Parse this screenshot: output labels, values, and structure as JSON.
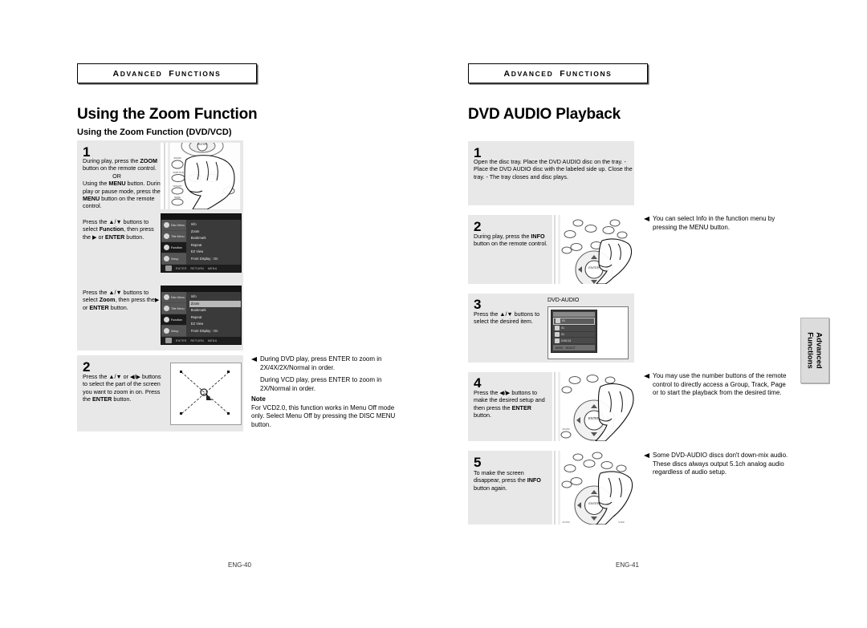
{
  "document": {
    "type": "product-manual-spread",
    "banner_label": "ADVANCED FUNCTIONS"
  },
  "side_tab": {
    "line1": "Advanced",
    "line2": "Functions"
  },
  "left_page": {
    "banner": "ADVANCED FUNCTIONS",
    "title": "Using the Zoom Function",
    "subtitle": "Using the Zoom Function (DVD/VCD)",
    "folio": "ENG-40",
    "step1": {
      "number": "1",
      "lines": [
        "During play, press the ZOOM",
        "button on the remote control.",
        "OR",
        "Using the MENU button.",
        "During play or pause mode,",
        "press the MENU button on",
        "the remote control."
      ],
      "lines2": [
        "Press the ▲/▼ buttons to",
        "select Function, then",
        "press the ▶ or ENTER",
        "button."
      ],
      "lines3": [
        "Press the ▲/▼ buttons to",
        "select Zoom, then press",
        "the▶ or ENTER button."
      ]
    },
    "step2": {
      "number": "2",
      "lines": [
        "Press the ▲/▼ or ◀/▶",
        "buttons to select the part",
        "of the screen you want to",
        "zoom in on.",
        "Press the ENTER button."
      ]
    },
    "osd_menu_1": {
      "sidebar": [
        "Disc Menu",
        "Title Menu",
        "Function",
        "Setup"
      ],
      "selected_sidebar": "Function",
      "rows": [
        "Info",
        "Zoom",
        "Bookmark",
        "Repeat",
        "EZ View",
        "Front Display : On"
      ],
      "selected_row": "",
      "bottom": [
        "ENTER",
        "RETURN",
        "MENU"
      ]
    },
    "osd_menu_2": {
      "sidebar": [
        "Disc Menu",
        "Title Menu",
        "Function",
        "Setup"
      ],
      "selected_sidebar": "Function",
      "rows": [
        "Info",
        "Zoom",
        "Bookmark",
        "Repeat",
        "EZ View",
        "Front Display : On"
      ],
      "selected_row": "Zoom",
      "bottom": [
        "ENTER",
        "RETURN",
        "MENU"
      ]
    },
    "note_arrow": [
      "During DVD play, press ENTER to zoom in",
      "2X/4X/2X/Normal in order.",
      "",
      "During VCD play, press ENTER to zoom in",
      "2X/Normal in order."
    ],
    "note_block": {
      "heading": "Note",
      "lines": [
        "For VCD2.0, this function works in Menu Off mode",
        "only. Select Menu Off by pressing the DISC MENU",
        "button."
      ]
    }
  },
  "right_page": {
    "banner": "ADVANCED FUNCTIONS",
    "title": "DVD AUDIO Playback",
    "folio": "ENG-41",
    "step1": {
      "number": "1",
      "lines": [
        "Open the disc tray.",
        "Place the DVD AUDIO disc on the tray.",
        "- Place the DVD AUDIO disc with the labeled side up.",
        "Close the tray.",
        "- The tray closes and disc plays."
      ]
    },
    "step2": {
      "number": "2",
      "lines": [
        "During play, press the INFO",
        "button on the remote",
        "control."
      ],
      "note": [
        "You can select Info in the function menu by",
        "pressing the MENU button."
      ]
    },
    "step3": {
      "number": "3",
      "lines": [
        "Press the ▲/▼ buttons to",
        "select the desired item."
      ],
      "screen_label": "DVD-AUDIO",
      "osd": {
        "header": "DVD-AUDIO",
        "rows": [
          "01",
          "01",
          "01",
          "0:00:13"
        ],
        "selected_row_index": 0,
        "footer": [
          "MOVE",
          "SELECT"
        ]
      }
    },
    "step4": {
      "number": "4",
      "lines": [
        "Press the ◀/▶ buttons to",
        "make the desired setup and",
        "then press the ENTER",
        "button."
      ],
      "note": [
        "You may use the number buttons of the remote",
        "control to directly access a Group, Track, Page",
        "or to start the playback from the desired time."
      ]
    },
    "step5": {
      "number": "5",
      "lines": [
        "To make the screen",
        "disappear, press the INFO",
        "button again."
      ],
      "note": [
        "Some DVD-AUDIO discs don't down-mix audio.",
        "These discs always output 5.1ch analog audio",
        "regardless of audio setup."
      ]
    }
  }
}
